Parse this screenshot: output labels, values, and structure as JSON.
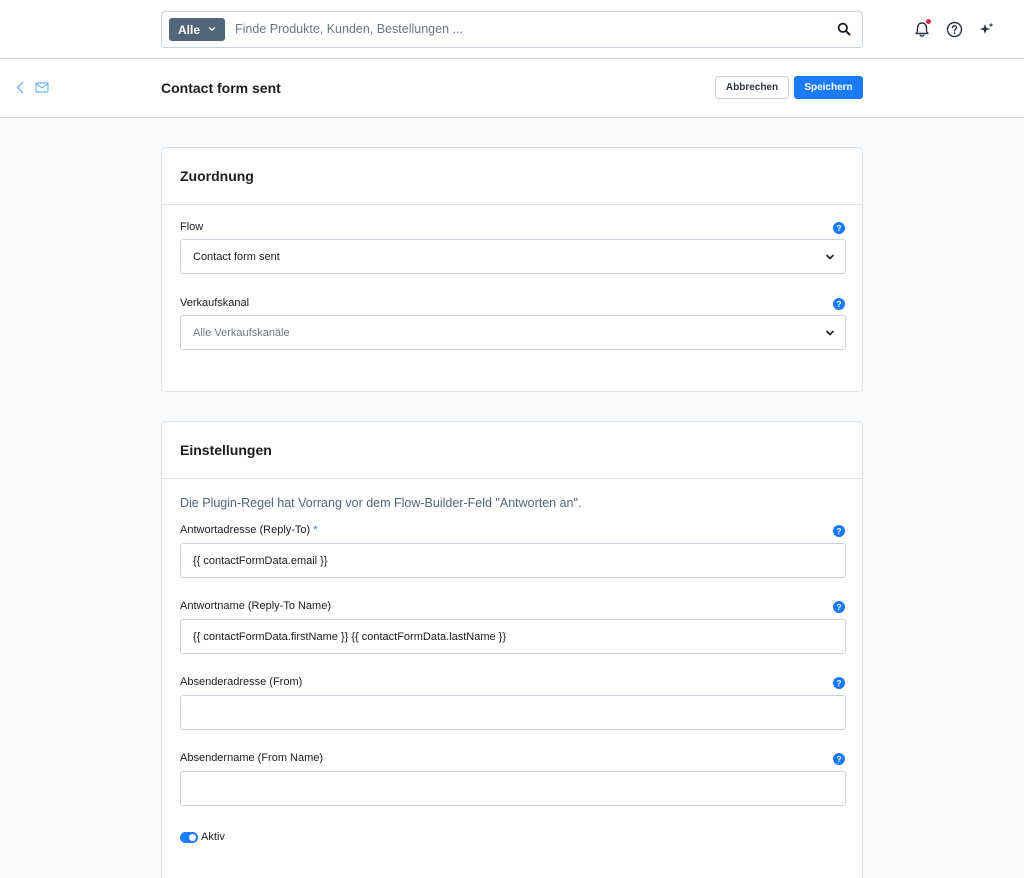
{
  "search": {
    "type_label": "Alle",
    "placeholder": "Finde Produkte, Kunden, Bestellungen ..."
  },
  "smartbar": {
    "title": "Contact form sent",
    "cancel_label": "Abbrechen",
    "save_label": "Speichern"
  },
  "assignment": {
    "title": "Zuordnung",
    "flow_label": "Flow",
    "flow_value": "Contact form sent",
    "channel_label": "Verkaufskanal",
    "channel_value": "Alle Verkaufskanäle"
  },
  "settings": {
    "title": "Einstellungen",
    "note": "Die Plugin-Regel hat Vorrang vor dem Flow-Builder-Feld \"Antworten an\".",
    "reply_to_label": "Antwortadresse (Reply-To)",
    "reply_to_required": "*",
    "reply_to_value": "{{ contactFormData.email }}",
    "reply_to_name_label": "Antwortname (Reply-To Name)",
    "reply_to_name_value": "{{ contactFormData.firstName }} {{ contactFormData.lastName }}",
    "from_label": "Absenderadresse (From)",
    "from_value": "",
    "from_name_label": "Absendername (From Name)",
    "from_name_value": "",
    "active_label": "Aktiv",
    "active": true
  },
  "help_glyph": "?",
  "colors": {
    "accent": "#1a7bff",
    "notification": "#de294c",
    "type_button": "#52667a"
  }
}
